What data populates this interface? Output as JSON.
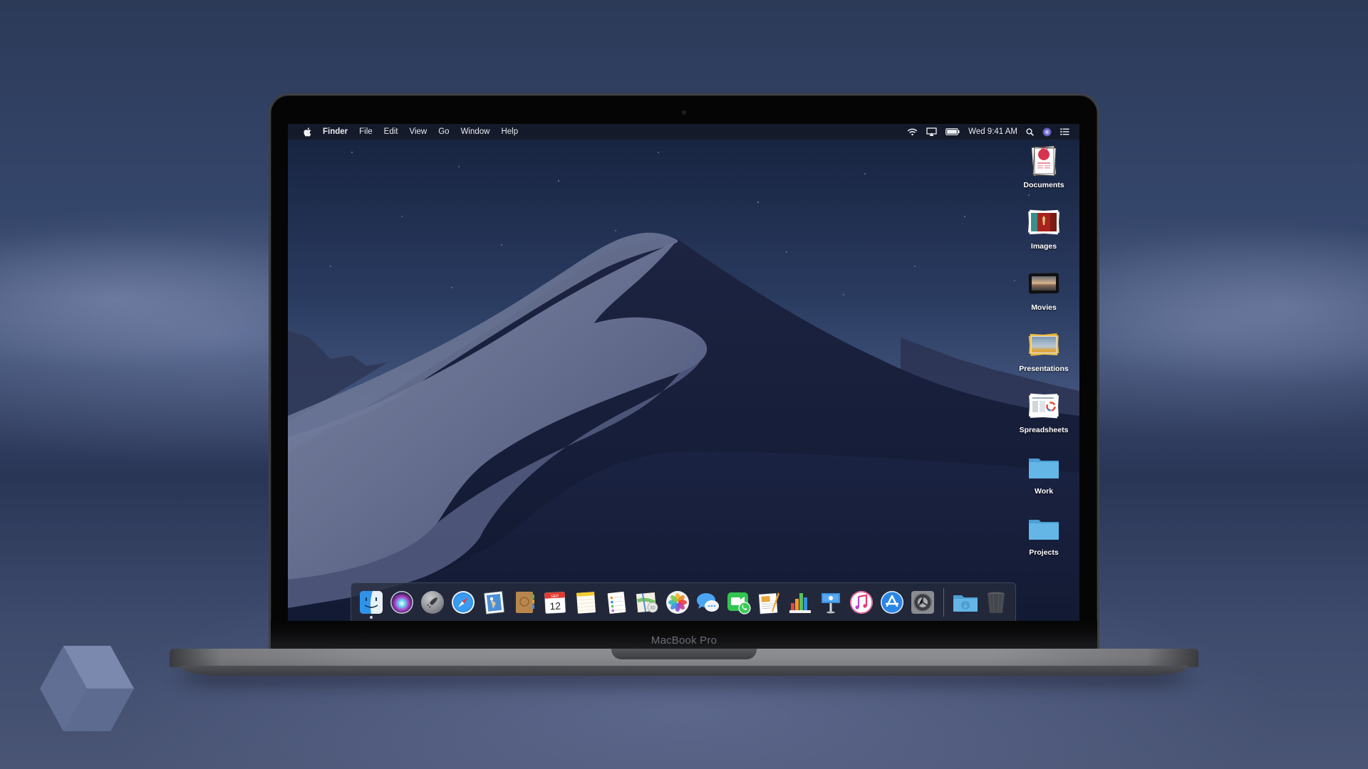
{
  "menubar": {
    "apple_menu": "apple-menu",
    "app_name": "Finder",
    "menus": [
      "File",
      "Edit",
      "View",
      "Go",
      "Window",
      "Help"
    ],
    "clock": "Wed 9:41 AM",
    "status_icons": [
      "wifi-icon",
      "airplay-icon",
      "battery-icon",
      "spotlight-icon",
      "siri-icon",
      "notification-center-icon"
    ]
  },
  "desktop": {
    "icons": [
      {
        "label": "Documents",
        "icon": "documents-stack-icon"
      },
      {
        "label": "Images",
        "icon": "images-stack-icon"
      },
      {
        "label": "Movies",
        "icon": "movies-stack-icon"
      },
      {
        "label": "Presentations",
        "icon": "presentations-stack-icon"
      },
      {
        "label": "Spreadsheets",
        "icon": "spreadsheets-stack-icon"
      },
      {
        "label": "Work",
        "icon": "folder-icon"
      },
      {
        "label": "Projects",
        "icon": "folder-icon"
      }
    ]
  },
  "dock": {
    "apps": [
      {
        "name": "Finder",
        "icon": "finder-icon",
        "running": true
      },
      {
        "name": "Siri",
        "icon": "siri-icon",
        "running": false
      },
      {
        "name": "Launchpad",
        "icon": "launchpad-icon",
        "running": false
      },
      {
        "name": "Safari",
        "icon": "safari-icon",
        "running": false
      },
      {
        "name": "Mail",
        "icon": "mail-icon",
        "running": false
      },
      {
        "name": "Contacts",
        "icon": "contacts-icon",
        "running": false
      },
      {
        "name": "Calendar",
        "icon": "calendar-icon",
        "running": false,
        "month": "SEP",
        "day": "12"
      },
      {
        "name": "Notes",
        "icon": "notes-icon",
        "running": false
      },
      {
        "name": "Reminders",
        "icon": "reminders-icon",
        "running": false
      },
      {
        "name": "Maps",
        "icon": "maps-icon",
        "running": false
      },
      {
        "name": "Photos",
        "icon": "photos-icon",
        "running": false
      },
      {
        "name": "Messages",
        "icon": "messages-icon",
        "running": false
      },
      {
        "name": "FaceTime",
        "icon": "facetime-icon",
        "running": false
      },
      {
        "name": "Pages",
        "icon": "pages-icon",
        "running": false
      },
      {
        "name": "Numbers",
        "icon": "numbers-icon",
        "running": false
      },
      {
        "name": "Keynote",
        "icon": "keynote-icon",
        "running": false
      },
      {
        "name": "iTunes",
        "icon": "itunes-icon",
        "running": false
      },
      {
        "name": "App Store",
        "icon": "app-store-icon",
        "running": false
      },
      {
        "name": "System Preferences",
        "icon": "system-preferences-icon",
        "running": false
      }
    ],
    "stacks": [
      {
        "name": "Downloads",
        "icon": "downloads-folder-icon"
      },
      {
        "name": "Trash",
        "icon": "trash-icon"
      }
    ]
  },
  "device": {
    "model_label": "MacBook Pro"
  },
  "colors": {
    "folder_blue": "#5fb4e4",
    "menubar_bg": "#141824",
    "dock_bg": "#262c3c"
  }
}
